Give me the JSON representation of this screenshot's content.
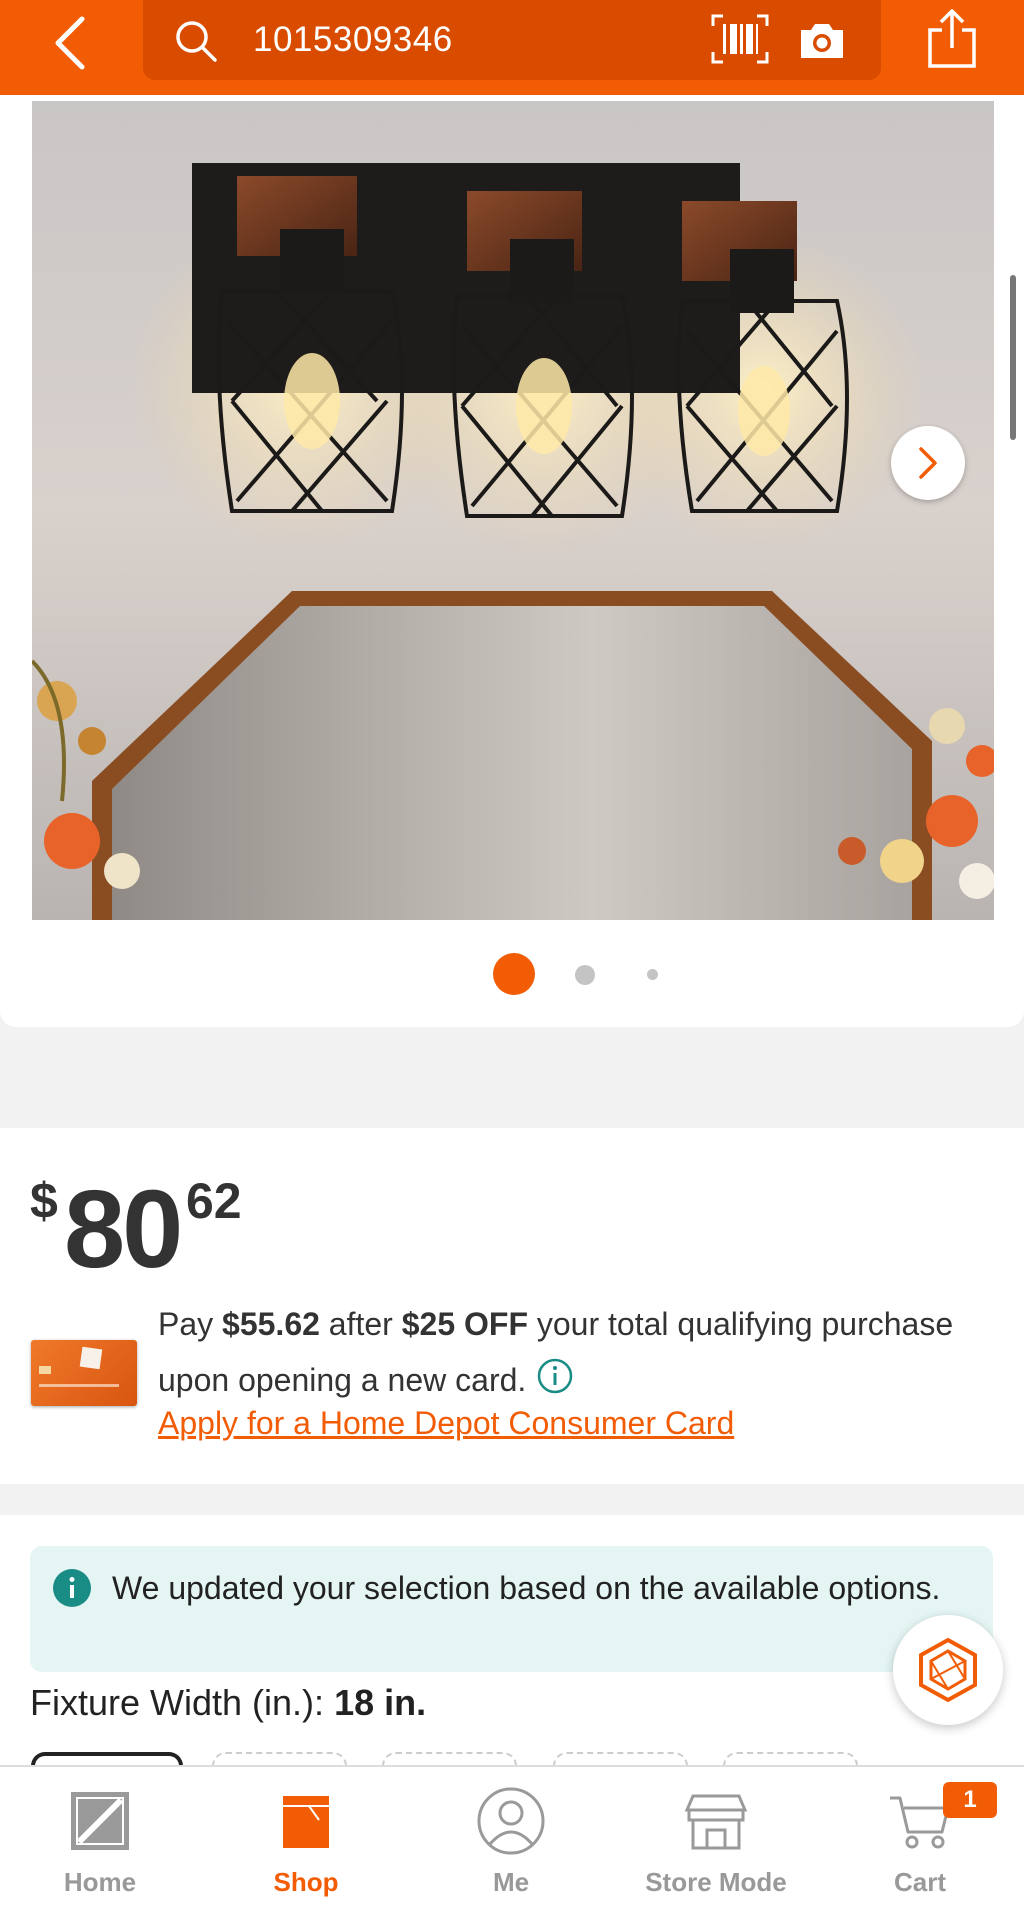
{
  "search": {
    "value": "1015309346"
  },
  "product": {
    "price": {
      "currency": "$",
      "dollars": "80",
      "cents": "62"
    },
    "image_carousel": {
      "total_images": 3,
      "active_index": 0
    }
  },
  "promo": {
    "pay_prefix": "Pay ",
    "pay_amount": "$55.62",
    "after_text": " after ",
    "discount": "$25 OFF",
    "rest_text": " your total qualifying purchase upon opening a new card.",
    "link_text": "Apply for a Home Depot Consumer Card"
  },
  "notice": {
    "text": "We updated your selection based on the available options."
  },
  "fixture": {
    "label": "Fixture Width (in.): ",
    "value": "18 in."
  },
  "bottom_nav": {
    "items": [
      {
        "label": "Home",
        "icon": "home-depot-logo-icon"
      },
      {
        "label": "Shop",
        "icon": "shop-bag-icon"
      },
      {
        "label": "Me",
        "icon": "person-icon"
      },
      {
        "label": "Store Mode",
        "icon": "store-icon"
      },
      {
        "label": "Cart",
        "icon": "cart-icon"
      }
    ],
    "active": "Shop",
    "cart_count": "1"
  },
  "colors": {
    "brand": "#f25c05",
    "brand_dark": "#d94c00",
    "notice_bg": "#e4f5f4",
    "info_teal": "#1a8c86"
  }
}
